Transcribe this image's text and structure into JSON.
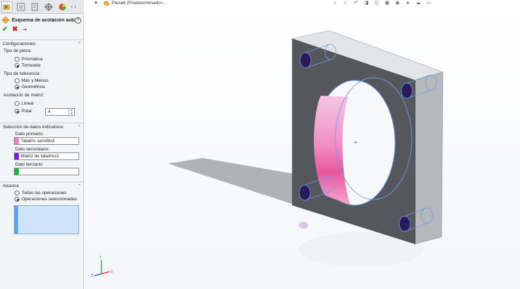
{
  "property_manager": {
    "title": "Esquema de acotación auto...",
    "help_label": "?",
    "configuraciones": {
      "header": "Configuraciones",
      "tipo_pieza_label": "Tipo de pieza:",
      "tipo_pieza_options": [
        "Prismática",
        "Torneada"
      ],
      "tipo_tolerancia_label": "Tipo de tolerancia:",
      "tipo_tolerancia_options": [
        "Más y Menos",
        "Geométrica"
      ],
      "acotacion_label": "Acotación de matriz:",
      "acotacion_options": [
        "Lineal",
        "Polar"
      ],
      "polar_value": "4"
    },
    "seleccion": {
      "header": "Selección de datos indicativos",
      "primario_label": "Dato primario:",
      "primario_value": "Taladro sencillo3",
      "primario_color": "#f07fb5",
      "secundario_label": "Dato secundario:",
      "secundario_value": "Matriz de taladros1",
      "secundario_color": "#7b18e6",
      "terciario_label": "Dato terciario:",
      "terciario_value": "",
      "terciario_color": "#19b83a"
    },
    "alcance": {
      "header": "Alcance",
      "options": [
        "Todas las operaciones",
        "Operaciones seleccionadas"
      ]
    }
  },
  "breadcrumb": {
    "text": "Pieza4  (Predeterminado<..."
  },
  "triad": {
    "x": "X",
    "y": "Y",
    "z": "Z"
  }
}
